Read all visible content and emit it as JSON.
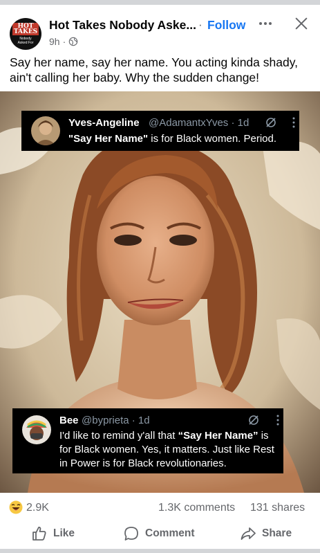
{
  "header": {
    "page_name": "Hot Takes Nobody Aske...",
    "separator": "·",
    "follow_label": "Follow",
    "time": "9h",
    "meta_dot": "·",
    "logo": {
      "title_line1": "HOT",
      "title_line2": "TAKES",
      "sub_line1": "Nobody",
      "sub_line2": "Asked For"
    }
  },
  "post": {
    "caption": "Say her name, say her name. You acting kinda shady, ain't calling her baby. Why the sudden change!"
  },
  "tweets": [
    {
      "name": "Yves-Angeline",
      "handle": "@AdamantxYves · 1d",
      "text_bold": "\"Say Her Name\"",
      "text_rest": " is for Black women. Period."
    },
    {
      "name": "Bee",
      "handle": "@byprieta · 1d",
      "text_pre": "I'd like to remind y'all that ",
      "text_bold": "“Say Her Name”",
      "text_rest": " is for Black women. Yes, it matters. Just like Rest in Power is for Black revolutionaries."
    }
  ],
  "stats": {
    "reaction_count": "2.9K",
    "comments": "1.3K comments",
    "shares": "131 shares"
  },
  "actions": {
    "like": "Like",
    "comment": "Comment",
    "share": "Share"
  },
  "colors": {
    "link_blue": "#1877f2",
    "muted_gray": "#65676b",
    "divider": "#d3d5d8"
  }
}
